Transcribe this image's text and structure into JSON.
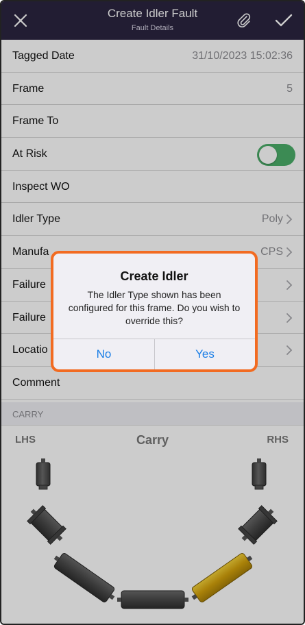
{
  "nav": {
    "title": "Create Idler Fault",
    "subtitle": "Fault Details",
    "close_icon": "close-icon",
    "attach_icon": "paperclip-icon",
    "done_icon": "checkmark-icon"
  },
  "rows": [
    {
      "label": "Tagged Date",
      "value": "31/10/2023 15:02:36"
    },
    {
      "label": "Frame",
      "value": "5"
    },
    {
      "label": "Frame To",
      "value": ""
    },
    {
      "label": "At Risk",
      "toggle": true
    },
    {
      "label": "Inspect WO",
      "value": ""
    },
    {
      "label": "Idler Type",
      "value": "Poly"
    },
    {
      "label": "Manufa",
      "value": "CPS"
    },
    {
      "label": "Failure",
      "value": ""
    },
    {
      "label": "Failure",
      "value": ""
    },
    {
      "label": "Locatio",
      "value": ""
    },
    {
      "label": "Comment",
      "value": ""
    }
  ],
  "section": {
    "label": "CARRY"
  },
  "diagram": {
    "lhs": "LHS",
    "carry": "Carry",
    "rhs": "RHS",
    "selected_roller": "right-wing-lower",
    "selected_color": "#e0b416"
  },
  "alert": {
    "title": "Create Idler",
    "message": "The Idler Type shown has been configured for this frame. Do you wish to override this?",
    "no": "No",
    "yes": "Yes"
  },
  "colors": {
    "navbar": "#2b2540",
    "toggle_on": "#4cae6a",
    "alert_border": "#f26b21",
    "link": "#1a7ee6"
  }
}
